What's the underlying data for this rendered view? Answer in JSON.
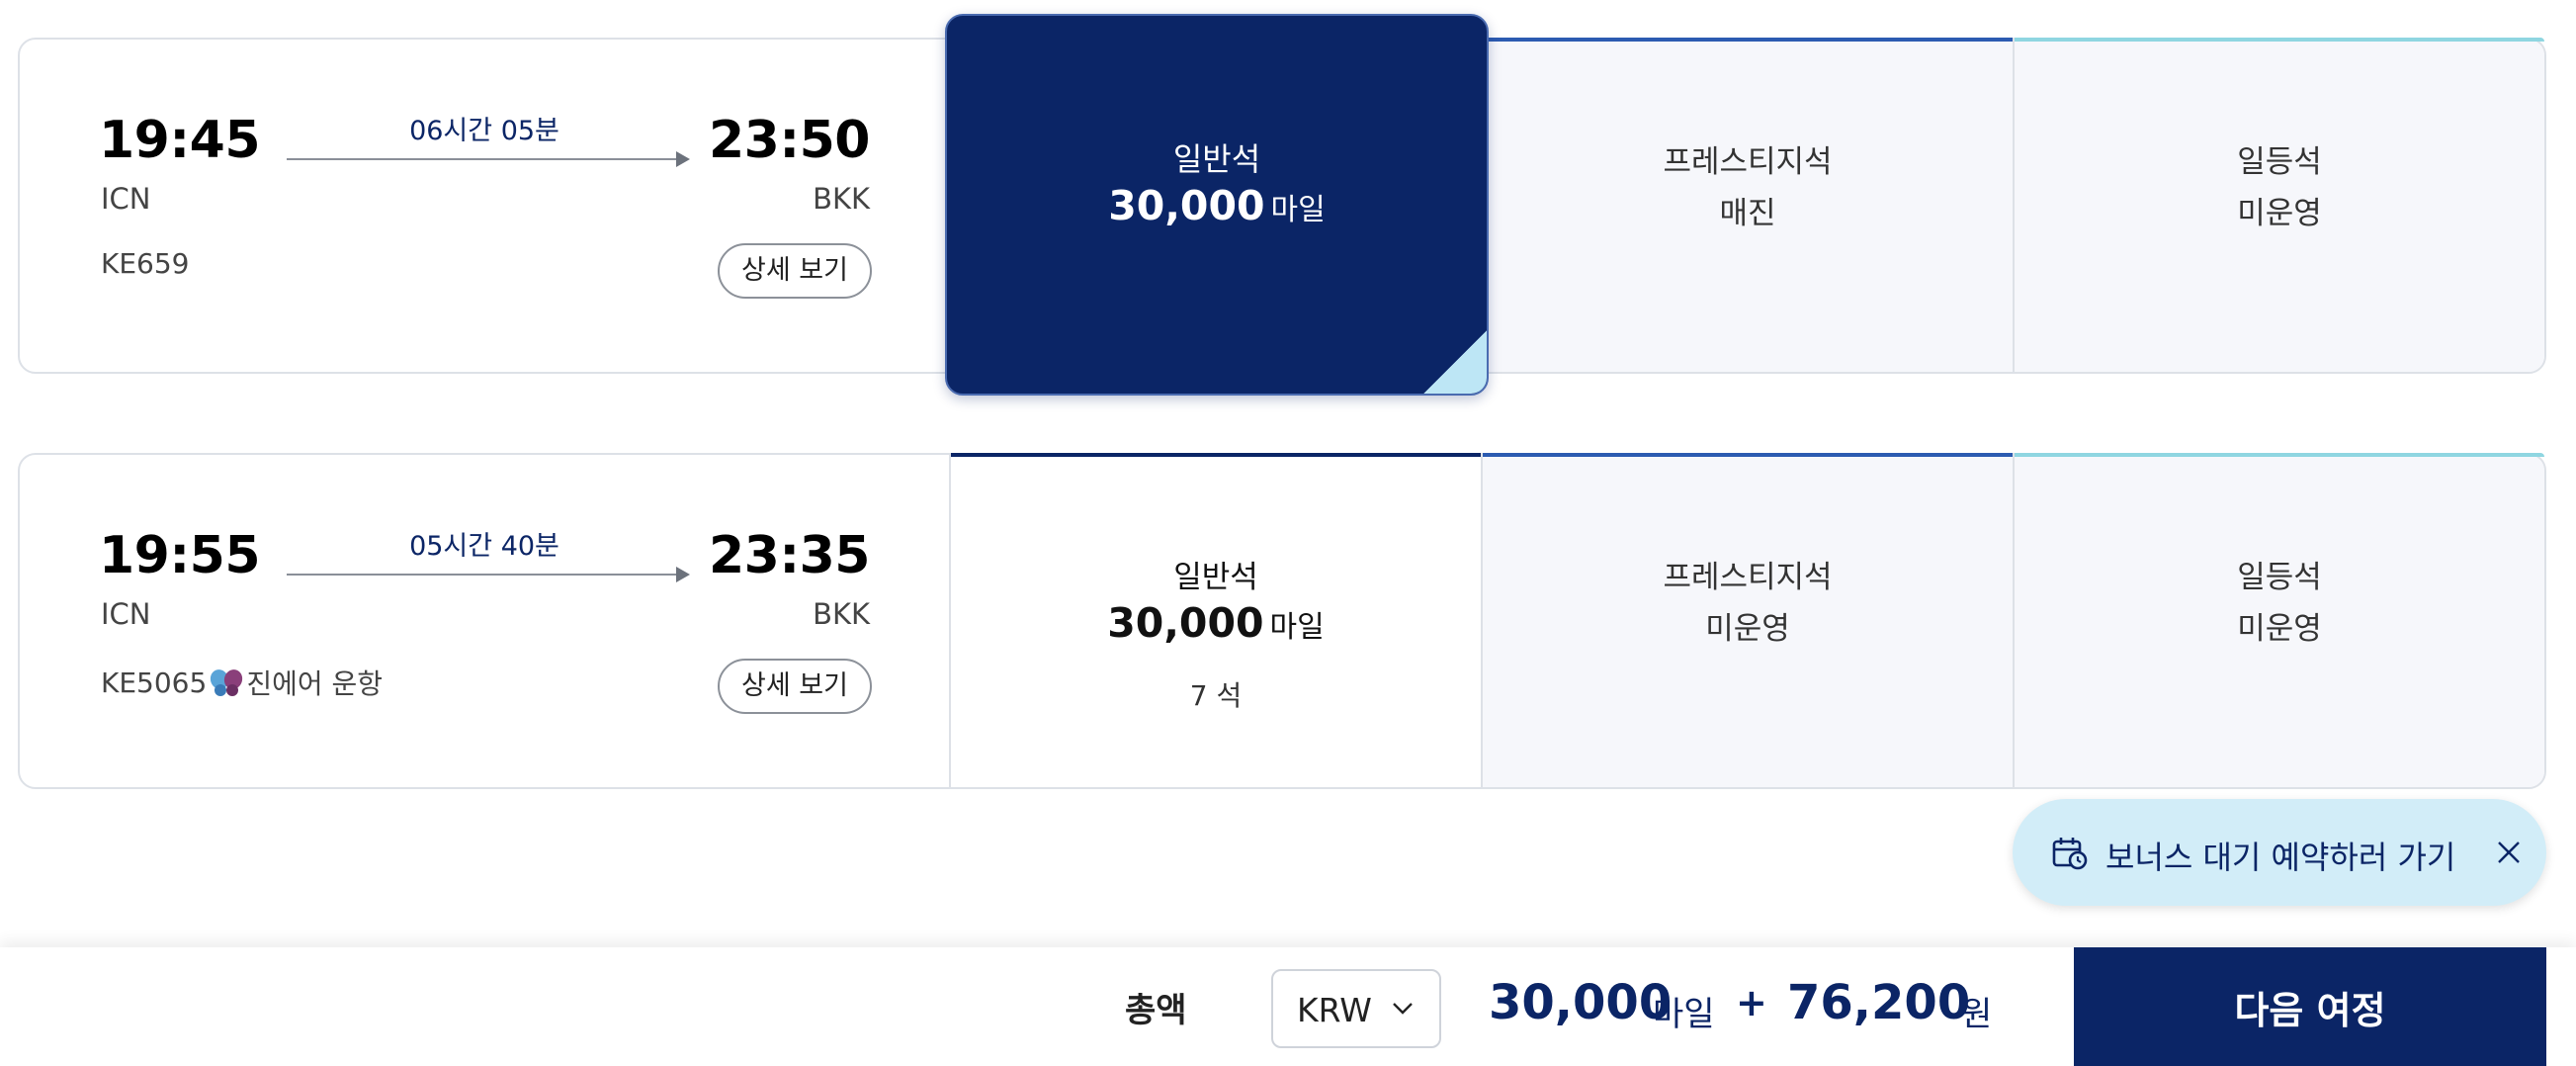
{
  "flights": [
    {
      "dep_time": "19:45",
      "dep_airport": "ICN",
      "arr_time": "23:50",
      "arr_airport": "BKK",
      "duration": "06시간 05분",
      "flight_no": "KE659",
      "operated_by": "",
      "detail_label": "상세 보기",
      "economy": {
        "name": "일반석",
        "miles": "30,000",
        "unit": "마일",
        "seats": ""
      },
      "prestige": {
        "name": "프레스티지석",
        "status": "매진"
      },
      "first": {
        "name": "일등석",
        "status": "미운영"
      }
    },
    {
      "dep_time": "19:55",
      "dep_airport": "ICN",
      "arr_time": "23:35",
      "arr_airport": "BKK",
      "duration": "05시간 40분",
      "flight_no": "KE5065",
      "operated_by": "진에어 운항",
      "detail_label": "상세 보기",
      "economy": {
        "name": "일반석",
        "miles": "30,000",
        "unit": "마일",
        "seats": "7 석"
      },
      "prestige": {
        "name": "프레스티지석",
        "status": "미운영"
      },
      "first": {
        "name": "일등석",
        "status": "미운영"
      }
    }
  ],
  "waitlist": {
    "label": "보너스 대기 예약하러 가기",
    "icon": "calendar-clock-icon"
  },
  "footer": {
    "total_label": "총액",
    "currency": "KRW",
    "total_miles": "30,000",
    "miles_unit": "마일",
    "plus": "+",
    "total_won": "76,200",
    "won_unit": "원",
    "next_button": "다음 여정"
  },
  "colors": {
    "navy": "#0b2566",
    "prestige_accent": "#2c5bb1",
    "first_accent": "#8fd6e1",
    "waitlist_bg": "#d2edf8"
  }
}
